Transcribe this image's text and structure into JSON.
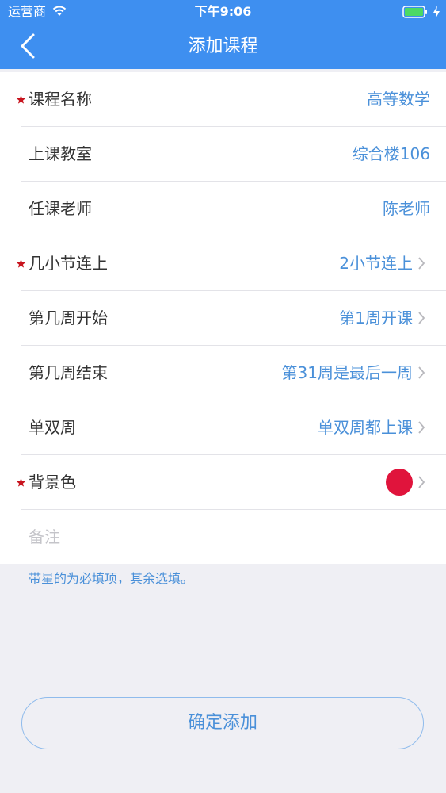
{
  "status_bar": {
    "carrier": "运营商",
    "time": "下午9:06"
  },
  "nav": {
    "title": "添加课程"
  },
  "rows": [
    {
      "label": "课程名称",
      "value": "高等数学",
      "required": true
    },
    {
      "label": "上课教室",
      "value": "综合楼106",
      "required": false
    },
    {
      "label": "任课老师",
      "value": "陈老师",
      "required": false
    },
    {
      "label": "几小节连上",
      "value": "2小节连上",
      "required": true
    },
    {
      "label": "第几周开始",
      "value": "第1周开课",
      "required": false
    },
    {
      "label": "第几周结束",
      "value": "第31周是最后一周",
      "required": false
    },
    {
      "label": "单双周",
      "value": "单双周都上课",
      "required": false
    },
    {
      "label": "背景色",
      "color": "#e0143c",
      "required": true
    }
  ],
  "note": {
    "placeholder": "备注"
  },
  "hint": "带星的为必填项，其余选填。",
  "confirm_button": "确定添加",
  "colors": {
    "accent": "#3e8ff0",
    "value_text": "#4a90d9",
    "required_star": "#c8141e"
  }
}
